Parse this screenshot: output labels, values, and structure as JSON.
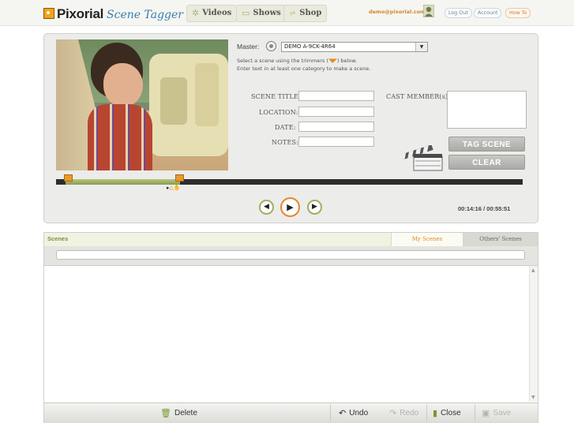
{
  "topbar": {
    "brand": "Pixorial",
    "app_name": "Scene Tagger",
    "nav": [
      {
        "label": "Videos",
        "icon": "film-reel-icon"
      },
      {
        "label": "Shows",
        "icon": "folder-icon"
      },
      {
        "label": "Shop",
        "icon": "cart-icon"
      }
    ],
    "email": "demo@pixorial.com",
    "logout": "Log Out",
    "account": "Account",
    "howto": "How To"
  },
  "editor": {
    "master_label": "Master:",
    "master_value": "DEMO A-9CK-4R64",
    "instruction_1a": "Select a scene using the trimmers (",
    "instruction_1b": ") below.",
    "instruction_2": "Enter text in at least one category to make a scene.",
    "fields": {
      "scene_title": "SCENE TITLE:",
      "location": "LOCATION:",
      "date": "DATE:",
      "notes": "NOTES:",
      "cast": "CAST MEMBER(s):"
    },
    "tag_button": "TAG SCENE",
    "clear_button": "CLEAR",
    "time_display": "00:14:16 / 00:55:51",
    "selection_start_fraction": 0.02,
    "selection_end_fraction": 0.265
  },
  "scenes": {
    "title": "Scenes",
    "tabs": [
      "My Scenes",
      "Others' Scenes"
    ],
    "footer": {
      "delete": "Delete",
      "undo": "Undo",
      "redo": "Redo",
      "close": "Close",
      "save": "Save"
    }
  },
  "colors": {
    "accent_orange": "#e7862b",
    "accent_green": "#9aab58",
    "track": "#2d2d2d"
  }
}
